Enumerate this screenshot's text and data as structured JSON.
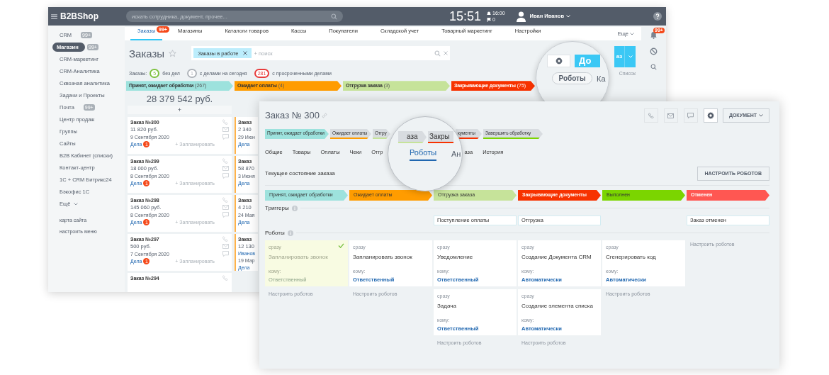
{
  "back_window": {
    "header": {
      "app_name": "B2BShop",
      "search_placeholder": "искать сотрудника, документ, прочее...",
      "clock": "15:51",
      "alarm_time": "16:00",
      "flag_count": "0",
      "user_name": "Иван Иванов"
    },
    "sidebar": {
      "items": [
        {
          "label": "CRM",
          "counter": "99+",
          "selected": false
        },
        {
          "label": "Магазин",
          "counter": "99+",
          "selected": true
        },
        {
          "label": "CRM-маркетинг",
          "selected": false
        },
        {
          "label": "CRM-Аналитика",
          "selected": false
        },
        {
          "label": "Сквозная аналитика",
          "selected": false
        },
        {
          "label": "Задачи и Проекты",
          "selected": false
        },
        {
          "label": "Почта",
          "counter": "99+",
          "selected": false
        },
        {
          "label": "Центр продаж",
          "selected": false
        },
        {
          "label": "Группы",
          "selected": false
        },
        {
          "label": "Сайты",
          "selected": false
        },
        {
          "label": "B2B Кабинет (списки)",
          "selected": false
        },
        {
          "label": "Контакт-центр",
          "selected": false
        },
        {
          "label": "1С + CRM Битрикс24",
          "selected": false
        },
        {
          "label": "Бэкофис 1С",
          "selected": false
        },
        {
          "label": "Ещё",
          "selected": false,
          "caret": true
        }
      ],
      "footer_links": [
        "карта сайта",
        "настроить меню"
      ]
    },
    "tabs": [
      {
        "label": "Заказы",
        "selected": true,
        "badge": "99+"
      },
      {
        "label": "Магазины",
        "selected": false
      },
      {
        "label": "Каталоги товаров",
        "selected": false
      },
      {
        "label": "Кассы",
        "selected": false
      },
      {
        "label": "Покупатели",
        "selected": false
      },
      {
        "label": "Складской учет",
        "selected": false
      },
      {
        "label": "Товарный маркетинг",
        "selected": false
      },
      {
        "label": "Настройки",
        "selected": false
      }
    ],
    "more_tab": "Еще",
    "page_title": "Заказы",
    "filter": {
      "tag": "Заказы в работе",
      "placeholder": "+ поиск"
    },
    "add_button_fragment": "аз",
    "lens": {
      "add_button_fragment": "До",
      "robots_button": "Роботы",
      "view_fragment": "Ка"
    },
    "list_link": "Список",
    "counters_label": "Заказы:",
    "counters": [
      {
        "count": "5",
        "label": "без дел",
        "color": "#7fc241"
      },
      {
        "count": "1",
        "label": "с делами на сегодня",
        "color": "#b0b5bb"
      },
      {
        "count": "281",
        "label": "с просроченными делами",
        "color": "#e83c3c"
      }
    ],
    "stages": [
      {
        "label": "Принят, ожидает обработки",
        "count": "(267)",
        "color": "#9de2dd"
      },
      {
        "label": "Ожидает оплаты",
        "count": "(4)",
        "color": "#ff9c00"
      },
      {
        "label": "Отгрузка заказа",
        "count": "(3)",
        "color": "#c6e39a"
      },
      {
        "label": "Закрывающие документы",
        "count": "(75)",
        "color": "#f73200"
      }
    ],
    "notification_badge": "99+",
    "first_column": {
      "sum": "28 379 542 руб.",
      "add_card_label": "+",
      "cards": [
        {
          "title": "Заказ №300",
          "sum": "11 820 руб.",
          "date": "9 Сентября 2020",
          "deals": "Дела",
          "deals_count": "1",
          "plan": "+ Запланировать"
        },
        {
          "title": "Заказ №299",
          "sum": "18 000 руб.",
          "date": "8 Сентября 2020",
          "deals": "Дела",
          "deals_count": "1",
          "plan": "+ Запланировать"
        },
        {
          "title": "Заказ №298",
          "sum": "145 060 руб.",
          "date": "8 Сентября 2020",
          "deals": "Дела",
          "deals_count": "1",
          "plan": "+ Запланировать"
        },
        {
          "title": "Заказ №297",
          "sum": "500 руб.",
          "date": "7 Сентября 2020",
          "deals": "Дела",
          "deals_count": "1",
          "plan": "+ Запланировать"
        },
        {
          "title": "Заказ №294"
        }
      ]
    },
    "second_column": {
      "cards": [
        {
          "title": "Заказ",
          "sum": "2 340",
          "date": "29 Июн",
          "deals": "Дела"
        },
        {
          "title": "Заказ",
          "sum": "58 870",
          "date": "3 Июня",
          "deals": "Дела"
        },
        {
          "title": "Заказ",
          "sum": "4 210",
          "date": "24 Мая",
          "deals": "Дела"
        },
        {
          "title": "Заказ",
          "sum": "12 130",
          "contact": "Иванов",
          "date": "19 Мар",
          "deals": "Дела"
        }
      ]
    }
  },
  "front_window": {
    "title": "Заказ № 300",
    "document_button": "ДОКУМЕНТ",
    "stage_chips": [
      {
        "label": "Принят, ожидает обработки",
        "color": "#9de2dd",
        "current": true
      },
      {
        "label": "Ожидает оплаты",
        "color": "#ff9c00",
        "current": false
      },
      {
        "label": "Отгру",
        "color": "#c6e39a",
        "current": false
      },
      {
        "label": "кументы",
        "color": "#f73200",
        "current": false
      },
      {
        "label": "Завершить обработку",
        "color": "#7bd500",
        "current": false
      }
    ],
    "tabs_left": [
      {
        "label": "Общие",
        "selected": false
      },
      {
        "label": "Товары",
        "selected": false
      },
      {
        "label": "Оплаты",
        "selected": false
      },
      {
        "label": "Чеки",
        "selected": false
      },
      {
        "label": "Отгр",
        "selected": false
      }
    ],
    "tabs_right": [
      {
        "label": "аза",
        "selected": false
      },
      {
        "label": "История",
        "selected": false
      }
    ],
    "lens": {
      "stage_fragments": [
        {
          "label": "аза",
          "color": "#c6e39a"
        },
        {
          "label": "Закры",
          "color": "#f73200"
        }
      ],
      "tabs": [
        {
          "label": "Роботы",
          "selected": true
        },
        {
          "label": "Ан",
          "selected": false
        }
      ]
    },
    "section_title": "Текущее состояние заказа",
    "setup_button": "НАСТРОИТЬ РОБОТОВ",
    "triggers_title": "Триггеры",
    "robots_title": "Роботы",
    "columns": [
      {
        "stage": "Принят, ожидает обработки",
        "color": "#9de2dd",
        "robots": [
          {
            "when": "сразу",
            "title": "Запланировать звонок",
            "to_label": "кому:",
            "to": "Ответственный",
            "done": true
          }
        ],
        "setup_link": "Настроить роботов"
      },
      {
        "stage": "Ожидает оплаты",
        "color": "#ff9c00",
        "robots": [
          {
            "when": "сразу",
            "title": "Запланировать звонок",
            "to_label": "кому:",
            "to": "Ответственный",
            "done": false
          }
        ],
        "setup_link": "Настроить роботов"
      },
      {
        "stage": "Отгрузка заказа",
        "color": "#c6e39a",
        "trigger": "Поступление оплаты",
        "robots": [
          {
            "when": "сразу",
            "title": "Уведомление",
            "to_label": "кому:",
            "to": "Ответственный",
            "done": false
          },
          {
            "when": "сразу",
            "title": "Задача",
            "to_label": "кому:",
            "to": "Ответственный",
            "done": false
          }
        ],
        "setup_link": "Настроить роботов"
      },
      {
        "stage": "Закрывающие документы",
        "color": "#f73200",
        "trigger": "Отгрузка",
        "robots": [
          {
            "when": "сразу",
            "title": "Создание Документа CRM",
            "to_label": "кому:",
            "to": "Автоматически",
            "done": false
          },
          {
            "when": "сразу",
            "title": "Создание элемента списка",
            "to_label": "кому:",
            "to": "Автоматически",
            "done": false
          }
        ],
        "setup_link": "Настроить роботов"
      },
      {
        "stage": "Выполнен",
        "color": "#7bd500",
        "robots": [
          {
            "when": "сразу",
            "title": "Сгенерировать код",
            "to_label": "кому:",
            "to": "Автоматически",
            "done": false
          }
        ],
        "setup_link": "Настроить роботов"
      },
      {
        "stage": "Отменен",
        "color": "#ff5752",
        "trigger": "Заказ отменен",
        "setup_link": "Настроить роботов"
      }
    ]
  }
}
